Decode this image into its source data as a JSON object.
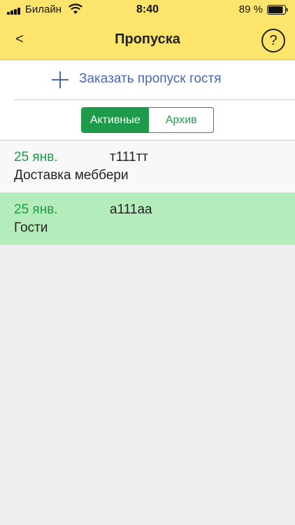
{
  "status_bar": {
    "carrier": "Билайн",
    "time": "8:40",
    "battery_percent": "89 %",
    "battery_level": 0.89
  },
  "header": {
    "back_label": "<",
    "title": "Пропуска",
    "help_label": "?"
  },
  "actions": {
    "order_guest_pass": "Заказать пропуск гостя"
  },
  "tabs": [
    {
      "label": "Активные",
      "selected": true
    },
    {
      "label": "Архив",
      "selected": false
    }
  ],
  "passes": [
    {
      "date": "25 янв.",
      "plate": "т111тт",
      "description": "Доставка меббери"
    },
    {
      "date": "25 янв.",
      "plate": "а111аа",
      "description": "Гости"
    }
  ],
  "colors": {
    "header_bg": "#fde46a",
    "accent_green": "#1d9b4b",
    "link_blue": "#4767b8",
    "selected_row_bg": "#b5ecbb",
    "background": "#efefef"
  }
}
